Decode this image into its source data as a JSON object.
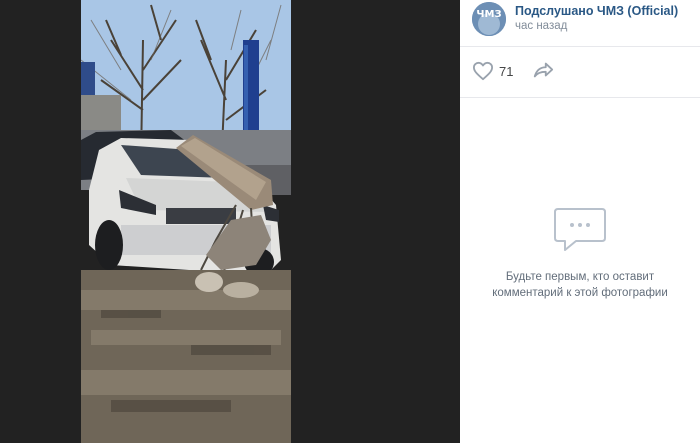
{
  "post": {
    "author": "Подслушано ЧМЗ (Official)",
    "time": "час назад",
    "avatar_text": "ЧМЗ",
    "likes": "71"
  },
  "icons": {
    "like": "heart-icon",
    "share": "share-arrow-icon",
    "empty": "comment-bubble-icon"
  },
  "comments": {
    "empty_text": "Будьте первым, кто оставит комментарий к этой фотографии"
  },
  "colors": {
    "accent": "#2a5885",
    "icon": "#99a2ad",
    "viewer_bg": "#222222"
  }
}
